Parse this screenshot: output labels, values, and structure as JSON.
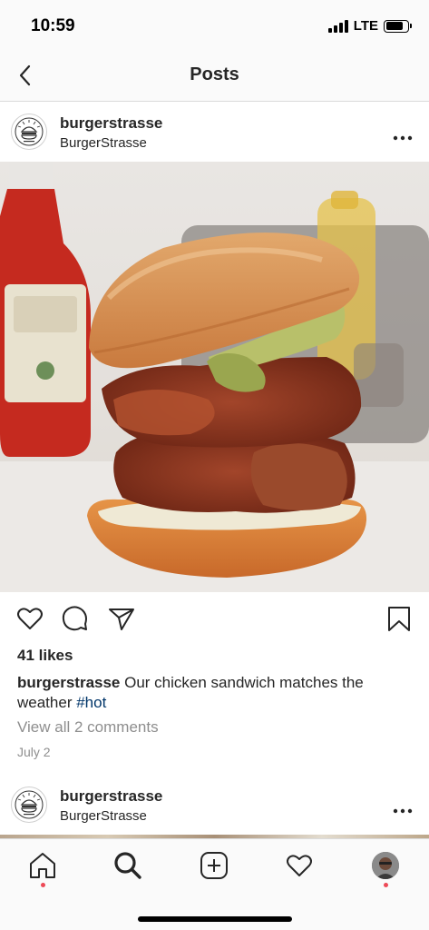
{
  "status_bar": {
    "time": "10:59",
    "network": "LTE",
    "battery_level": 0.82
  },
  "nav": {
    "title": "Posts",
    "back_icon": "chevron-left-icon"
  },
  "post": {
    "username": "burgerstrasse",
    "subtitle": "BurgerStrasse",
    "more_icon": "more-horizontal-icon",
    "image_subject": "fried chicken sandwich",
    "actions": [
      "heart-icon",
      "comment-icon",
      "share-icon",
      "bookmark-icon"
    ],
    "likes": "41 likes",
    "caption_user": "burgerstrasse",
    "caption_text": "Our chicken sandwich matches the weather",
    "caption_tag": "#hot",
    "view_comments": "View all 2 comments",
    "date": "July 2"
  },
  "next_post": {
    "username": "burgerstrasse",
    "subtitle": "BurgerStrasse"
  },
  "tab_bar": {
    "items": [
      "home-icon",
      "search-icon",
      "add-post-icon",
      "activity-heart-icon",
      "profile-avatar"
    ],
    "badge_color": "#ed4956"
  },
  "colors": {
    "hashtag": "#003569",
    "muted": "#8e8e8e",
    "text": "#262626"
  }
}
